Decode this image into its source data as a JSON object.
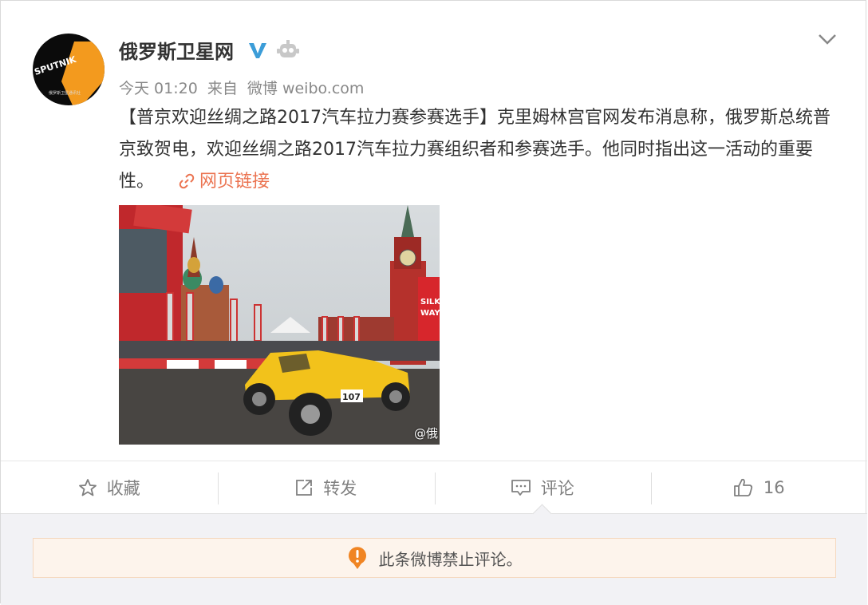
{
  "post": {
    "author": "俄罗斯卫星网",
    "avatar_text": "SPUTNIK",
    "avatar_subtext": "俄罗斯卫星通讯社",
    "time": "今天 01:20",
    "source_prefix": "来自",
    "source": "微博 weibo.com",
    "text": "【普京欢迎丝绸之路2017汽车拉力赛参赛选手】克里姆林宫官网发布消息称，俄罗斯总统普京致贺电，欢迎丝绸之路2017汽车拉力赛组织者和参赛选手。他同时指出这一活动的重要性。",
    "link_label": "网页链接",
    "photo_watermark": "@俄",
    "car_number": "107"
  },
  "toolbar": {
    "favorite": "收藏",
    "repost": "转发",
    "comment": "评论",
    "like_count": "16"
  },
  "comments": {
    "notice": "此条微博禁止评论。"
  },
  "colors": {
    "link": "#eb7350",
    "verified": "#3c9dd8",
    "notice_icon": "#f08524"
  }
}
